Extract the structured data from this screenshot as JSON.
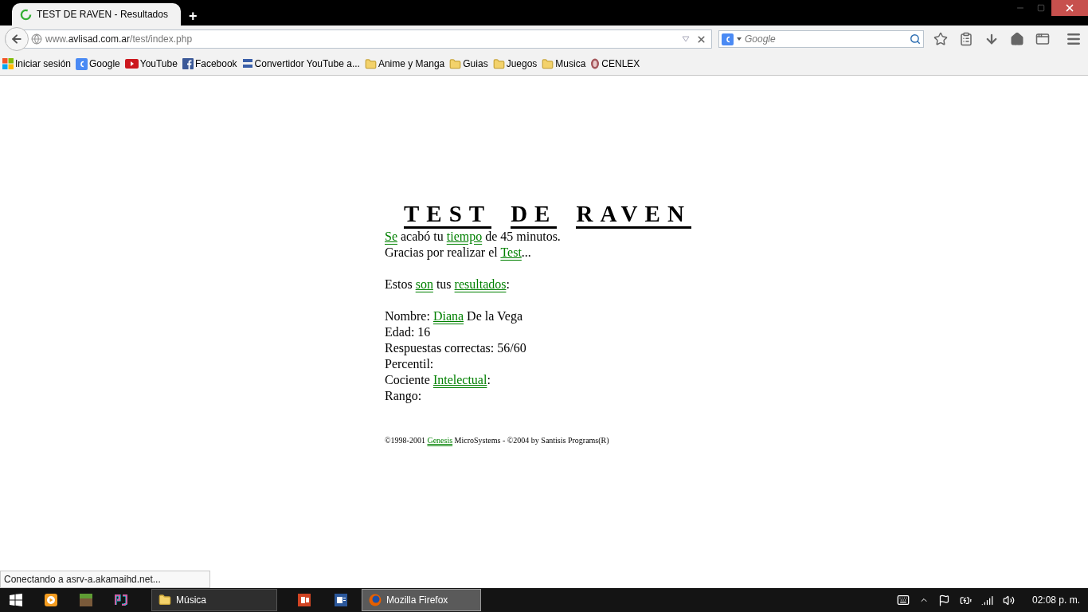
{
  "browser": {
    "tab": {
      "title": "TEST DE RAVEN - Resultados",
      "loading": true
    },
    "new_tab": "+",
    "url": {
      "host_prefix": "www.",
      "host": "avlisad.com.ar",
      "path": "/test/index.php"
    },
    "search": {
      "placeholder": "Google"
    },
    "bookmarks": [
      {
        "label": "Iniciar sesión",
        "kind": "windows"
      },
      {
        "label": "Google",
        "kind": "google"
      },
      {
        "label": "YouTube",
        "kind": "youtube"
      },
      {
        "label": "Facebook",
        "kind": "facebook"
      },
      {
        "label": "Convertidor YouTube a...",
        "kind": "ytmp3"
      },
      {
        "label": "Anime y Manga",
        "kind": "folder"
      },
      {
        "label": "Guias",
        "kind": "folder"
      },
      {
        "label": "Juegos",
        "kind": "folder"
      },
      {
        "label": "Musica",
        "kind": "folder"
      },
      {
        "label": "CENLEX",
        "kind": "site"
      }
    ]
  },
  "page": {
    "title": [
      "TEST",
      "DE",
      "RAVEN"
    ],
    "paragraphs": [
      [
        [
          {
            "kind": "link",
            "text": "Se"
          },
          {
            "kind": "text",
            "text": " acabó tu "
          },
          {
            "kind": "link",
            "text": "tiempo"
          },
          {
            "kind": "text",
            "text": " de 45 minutos."
          }
        ],
        [
          {
            "kind": "text",
            "text": "Gracias por realizar el "
          },
          {
            "kind": "link",
            "text": "Test"
          },
          {
            "kind": "text",
            "text": "..."
          }
        ]
      ],
      [
        [
          {
            "kind": "text",
            "text": "Estos "
          },
          {
            "kind": "link",
            "text": "son"
          },
          {
            "kind": "text",
            "text": " tus "
          },
          {
            "kind": "link",
            "text": "resultados"
          },
          {
            "kind": "text",
            "text": ":"
          }
        ]
      ],
      [
        [
          {
            "kind": "text",
            "text": "Nombre: "
          },
          {
            "kind": "link",
            "text": "Diana"
          },
          {
            "kind": "text",
            "text": " De la Vega"
          }
        ],
        [
          {
            "kind": "text",
            "text": "Edad: 16"
          }
        ],
        [
          {
            "kind": "text",
            "text": "Respuestas correctas: 56/60"
          }
        ],
        [
          {
            "kind": "text",
            "text": "Percentil:"
          }
        ],
        [
          {
            "kind": "text",
            "text": "Cociente "
          },
          {
            "kind": "link",
            "text": "Intelectual"
          },
          {
            "kind": "text",
            "text": ":"
          }
        ],
        [
          {
            "kind": "text",
            "text": "Rango:"
          }
        ]
      ]
    ],
    "footer": [
      {
        "kind": "text",
        "text": "©1998-2001 "
      },
      {
        "kind": "link",
        "text": "Genesis"
      },
      {
        "kind": "text",
        "text": " MicroSystems - ©2004 by Santisis Programs(R)"
      }
    ]
  },
  "status_text": "Conectando a asrv-a.akamaihd.net...",
  "taskbar": {
    "windows": [
      {
        "label": "Música",
        "kind": "folder",
        "selected": false
      },
      {
        "label": "Mozilla Firefox",
        "kind": "firefox",
        "selected": true
      }
    ],
    "clock": "02:08 p. m."
  }
}
